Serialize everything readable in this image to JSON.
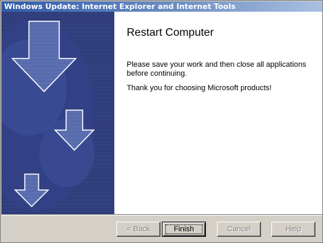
{
  "window": {
    "title": "Windows Update: Internet Explorer and Internet Tools"
  },
  "main": {
    "heading": "Restart Computer",
    "paragraph1": "Please save your work and then close all applications before continuing.",
    "paragraph2": "Thank you for choosing Microsoft products!"
  },
  "side_panel": {
    "icon": "down-arrows-illustration",
    "colors": {
      "background": "#27346c",
      "arrow_fill": "#5568a8",
      "arrow_outline": "#ffffff"
    }
  },
  "buttons": {
    "back": "< Back",
    "finish": "Finish",
    "cancel": "Cancel",
    "help": "Help"
  },
  "colors": {
    "titlebar_start": "#2f5aa8",
    "titlebar_end": "#a9c0e0",
    "dialog_face": "#d4d0c8"
  }
}
